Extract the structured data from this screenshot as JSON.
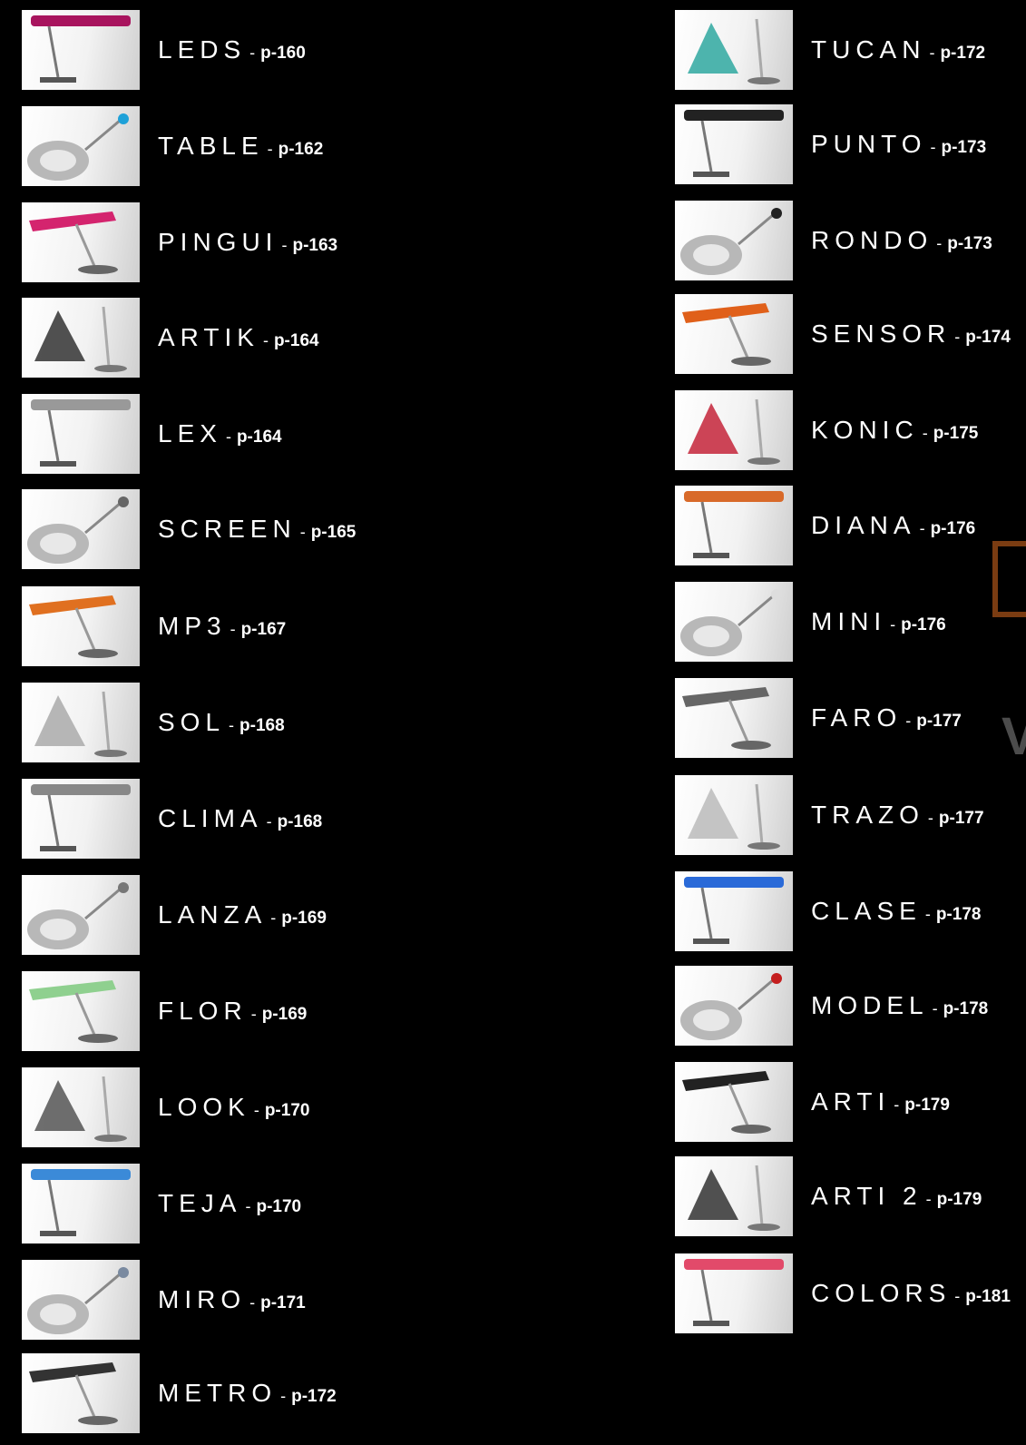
{
  "left_column": [
    {
      "name": "LEDS",
      "page": "p-160",
      "icon": "leds-lamp-icon"
    },
    {
      "name": "TABLE",
      "page": "p-162",
      "icon": "table-lamp-icon"
    },
    {
      "name": "PINGUI",
      "page": "p-163",
      "icon": "pingui-lamp-icon"
    },
    {
      "name": "ARTIK",
      "page": "p-164",
      "icon": "artik-lamp-icon"
    },
    {
      "name": "LEX",
      "page": "p-164",
      "icon": "lex-lamp-icon"
    },
    {
      "name": "SCREEN",
      "page": "p-165",
      "icon": "screen-lamp-icon"
    },
    {
      "name": "MP3",
      "page": "p-167",
      "icon": "mp3-lamp-icon"
    },
    {
      "name": "SOL",
      "page": "p-168",
      "icon": "sol-lamp-icon"
    },
    {
      "name": "CLIMA",
      "page": "p-168",
      "icon": "clima-lamp-icon"
    },
    {
      "name": "LANZA",
      "page": "p-169",
      "icon": "lanza-lamp-icon"
    },
    {
      "name": "FLOR",
      "page": "p-169",
      "icon": "flor-lamp-icon"
    },
    {
      "name": "LOOK",
      "page": "p-170",
      "icon": "look-lamp-icon"
    },
    {
      "name": "TEJA",
      "page": "p-170",
      "icon": "teja-lamp-icon"
    },
    {
      "name": "MIRO",
      "page": "p-171",
      "icon": "miro-lamp-icon"
    },
    {
      "name": "METRO",
      "page": "p-172",
      "icon": "metro-lamp-icon"
    }
  ],
  "right_column": [
    {
      "name": "TUCAN",
      "page": "p-172",
      "icon": "tucan-lamp-icon"
    },
    {
      "name": "PUNTO",
      "page": "p-173",
      "icon": "punto-lamp-icon"
    },
    {
      "name": "RONDO",
      "page": "p-173",
      "icon": "rondo-lamp-icon"
    },
    {
      "name": "SENSOR",
      "page": "p-174",
      "icon": "sensor-lamp-icon"
    },
    {
      "name": "KONIC",
      "page": "p-175",
      "icon": "konic-lamp-icon"
    },
    {
      "name": "DIANA",
      "page": "p-176",
      "icon": "diana-lamp-icon"
    },
    {
      "name": "MINI",
      "page": "p-176",
      "icon": "mini-lamp-icon"
    },
    {
      "name": "FARO",
      "page": "p-177",
      "icon": "faro-lamp-icon"
    },
    {
      "name": "TRAZO",
      "page": "p-177",
      "icon": "trazo-lamp-icon"
    },
    {
      "name": "CLASE",
      "page": "p-178",
      "icon": "clase-lamp-icon"
    },
    {
      "name": "MODEL",
      "page": "p-178",
      "icon": "model-lamp-icon"
    },
    {
      "name": "ARTI",
      "page": "p-179",
      "icon": "arti-lamp-icon"
    },
    {
      "name": "ARTI 2",
      "page": "p-179",
      "icon": "arti-2-lamp-icon"
    },
    {
      "name": "COLORS",
      "page": "p-181",
      "icon": "colors-lamp-icon"
    }
  ],
  "separator": "-",
  "colors": {
    "background": "#000000",
    "text": "#ffffff",
    "brand_frame": "#7a3c12",
    "brand_letter": "#4c4c4c"
  },
  "brand_letter": "V"
}
